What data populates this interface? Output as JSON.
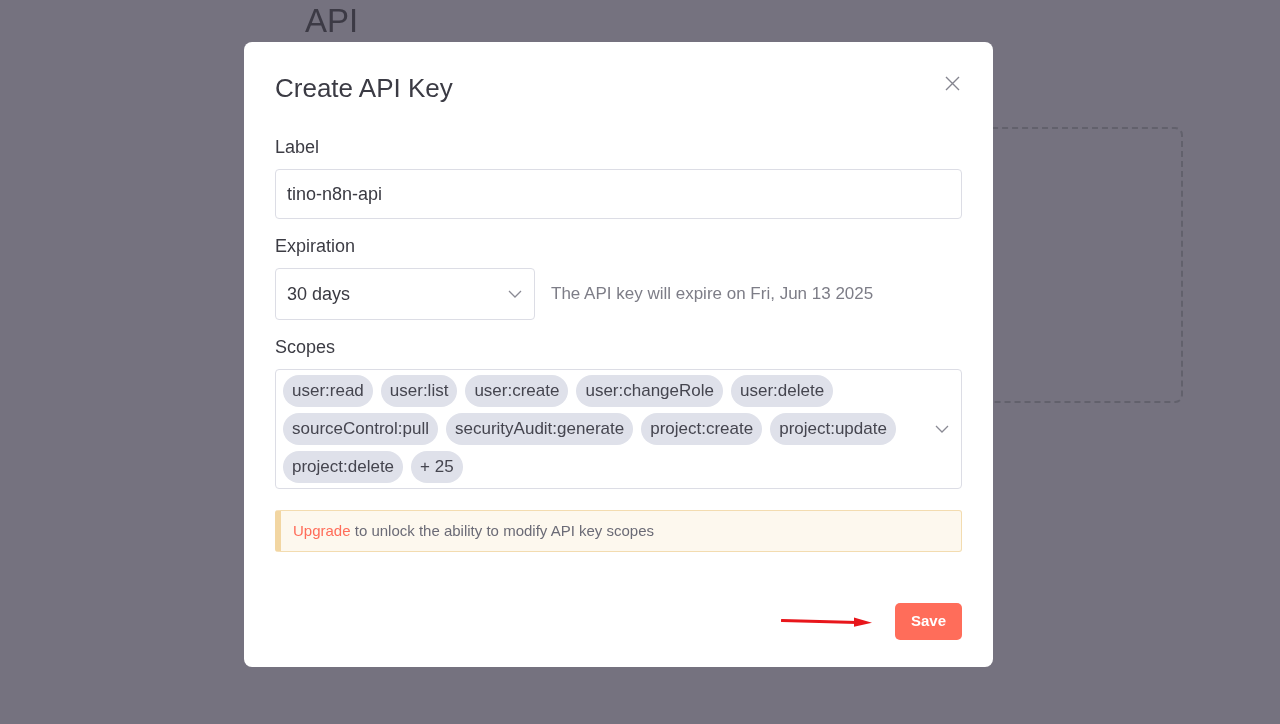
{
  "page": {
    "heading": "API"
  },
  "dialog": {
    "title": "Create API Key",
    "fields": [
      {
        "kind": "input",
        "label": "Label",
        "value": "tino-n8n-api"
      },
      {
        "kind": "select",
        "label": "Expiration",
        "value": "30 days",
        "note": "The API key will expire on Fri, Jun 13 2025"
      },
      {
        "kind": "tags",
        "label": "Scopes",
        "tags": [
          "user:read",
          "user:list",
          "user:create",
          "user:changeRole",
          "user:delete",
          "sourceControl:pull",
          "securityAudit:generate",
          "project:create",
          "project:update",
          "project:delete"
        ],
        "more": "+ 25"
      }
    ],
    "notice": {
      "link": "Upgrade",
      "text": "to unlock the ability to modify API key scopes"
    },
    "buttons": [
      "Save"
    ]
  }
}
